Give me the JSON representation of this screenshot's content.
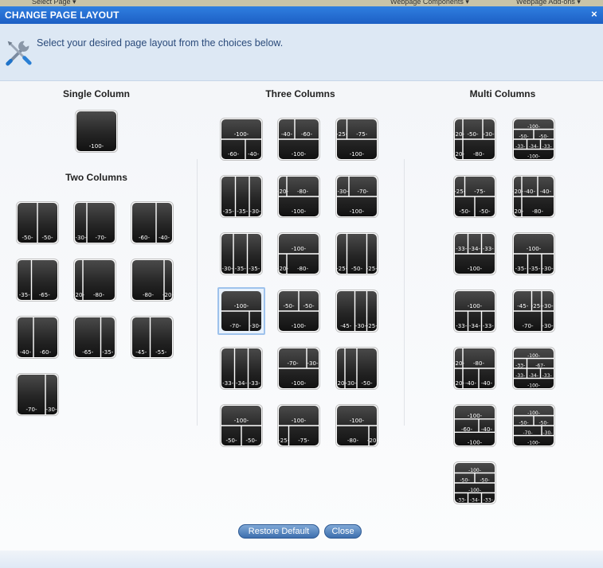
{
  "window": {
    "title": "CHANGE PAGE LAYOUT",
    "close_label": "×"
  },
  "background": {
    "item1": "Select Page ▾",
    "item2": "Webpage Components ▾",
    "item3": "Webpage Add-ons ▾"
  },
  "header": {
    "instruction": "Select your desired page layout from the choices below.",
    "icon": "wrench-screwdriver-icon"
  },
  "sections": {
    "single": "Single Column",
    "two": "Two Columns",
    "three": "Three Columns",
    "multi": "Multi Columns"
  },
  "buttons": {
    "restore": "Restore Default",
    "close": "Close"
  },
  "layouts": {
    "single": [
      {
        "label": "100",
        "rows": [
          [
            100
          ]
        ]
      }
    ],
    "two": [
      {
        "label": "50-50",
        "rows": [
          [
            50,
            50
          ]
        ]
      },
      {
        "label": "30-70",
        "rows": [
          [
            30,
            70
          ]
        ]
      },
      {
        "label": "60-40",
        "rows": [
          [
            60,
            40
          ]
        ]
      },
      {
        "label": "35-65",
        "rows": [
          [
            35,
            65
          ]
        ]
      },
      {
        "label": "20-80",
        "rows": [
          [
            20,
            80
          ]
        ]
      },
      {
        "label": "80-20",
        "rows": [
          [
            80,
            20
          ]
        ]
      },
      {
        "label": "40-60",
        "rows": [
          [
            40,
            60
          ]
        ]
      },
      {
        "label": "65-35",
        "rows": [
          [
            65,
            35
          ]
        ]
      },
      {
        "label": "45-55",
        "rows": [
          [
            45,
            55
          ]
        ]
      },
      {
        "label": "70-30",
        "rows": [
          [
            70,
            30
          ]
        ]
      }
    ],
    "three": [
      {
        "label": "100/60-40",
        "rows": [
          [
            100
          ],
          [
            60,
            40
          ]
        ]
      },
      {
        "label": "40-60/100",
        "rows": [
          [
            40,
            60
          ],
          [
            100
          ]
        ]
      },
      {
        "label": "25-75/100",
        "rows": [
          [
            25,
            75
          ],
          [
            100
          ]
        ]
      },
      {
        "label": "35-35-30",
        "rows": [
          [
            35,
            35,
            30
          ]
        ]
      },
      {
        "label": "20-80/100",
        "rows": [
          [
            20,
            80
          ],
          [
            100
          ]
        ]
      },
      {
        "label": "30-70/100",
        "rows": [
          [
            30,
            70
          ],
          [
            100
          ]
        ]
      },
      {
        "label": "30-35-35",
        "rows": [
          [
            30,
            35,
            35
          ]
        ]
      },
      {
        "label": "100/20-80",
        "rows": [
          [
            100
          ],
          [
            20,
            80
          ]
        ]
      },
      {
        "label": "25-50-25",
        "rows": [
          [
            25,
            50,
            25
          ]
        ]
      },
      {
        "label": "100/70-30",
        "rows": [
          [
            100
          ],
          [
            70,
            30
          ]
        ],
        "selected": true
      },
      {
        "label": "50-50/100",
        "rows": [
          [
            50,
            50
          ],
          [
            100
          ]
        ]
      },
      {
        "label": "45-30-25",
        "rows": [
          [
            45,
            30,
            25
          ]
        ]
      },
      {
        "label": "33-34-33",
        "rows": [
          [
            33,
            34,
            33
          ]
        ]
      },
      {
        "label": "70-30/100",
        "rows": [
          [
            70,
            30
          ],
          [
            100
          ]
        ]
      },
      {
        "label": "20-30-50",
        "rows": [
          [
            20,
            30,
            50
          ]
        ]
      },
      {
        "label": "100/50-50",
        "rows": [
          [
            100
          ],
          [
            50,
            50
          ]
        ]
      },
      {
        "label": "100/25-75",
        "rows": [
          [
            100
          ],
          [
            25,
            75
          ]
        ]
      },
      {
        "label": "100/80-20",
        "rows": [
          [
            100
          ],
          [
            80,
            20
          ]
        ]
      }
    ],
    "multi": [
      {
        "label": "20-50-30/80",
        "rows": [
          [
            20,
            50,
            30
          ],
          [
            20,
            80
          ]
        ]
      },
      {
        "label": "100/50-50/33-34-33/100",
        "rows": [
          [
            100
          ],
          [
            50,
            50
          ],
          [
            33,
            34,
            33
          ],
          [
            100
          ]
        ]
      },
      {
        "label": "25-75/50-50",
        "rows": [
          [
            25,
            75
          ],
          [
            50,
            50
          ]
        ]
      },
      {
        "label": "20-40-40/20-80",
        "rows": [
          [
            20,
            40,
            40
          ],
          [
            20,
            80
          ]
        ]
      },
      {
        "label": "33-34-33/100",
        "rows": [
          [
            33,
            34,
            33
          ],
          [
            100
          ]
        ]
      },
      {
        "label": "100/35-35-30",
        "rows": [
          [
            100
          ],
          [
            35,
            35,
            30
          ]
        ]
      },
      {
        "label": "100/33-34-33",
        "rows": [
          [
            100
          ],
          [
            33,
            34,
            33
          ]
        ]
      },
      {
        "label": "45-25-30/70-30",
        "rows": [
          [
            45,
            25,
            30
          ],
          [
            70,
            30
          ]
        ]
      },
      {
        "label": "20-80/20-40-40",
        "rows": [
          [
            20,
            80
          ],
          [
            20,
            40,
            40
          ]
        ]
      },
      {
        "label": "100/33-67/33-34-33/100",
        "rows": [
          [
            100
          ],
          [
            33,
            67
          ],
          [
            33,
            34,
            33
          ],
          [
            100
          ]
        ]
      },
      {
        "label": "100/60-40/100",
        "rows": [
          [
            100
          ],
          [
            60,
            40
          ],
          [
            100
          ]
        ]
      },
      {
        "label": "100/50-50/70-30/100",
        "rows": [
          [
            100
          ],
          [
            50,
            50
          ],
          [
            70,
            30
          ],
          [
            100
          ]
        ]
      },
      {
        "label": "100/50-50/100/33-34-33",
        "rows": [
          [
            100
          ],
          [
            50,
            50
          ],
          [
            100
          ],
          [
            33,
            34,
            33
          ]
        ]
      }
    ]
  },
  "colors": {
    "tile_dark": "#2b2b2b",
    "tile_light": "#4a4a4a",
    "accent": "#1d5fc4"
  }
}
